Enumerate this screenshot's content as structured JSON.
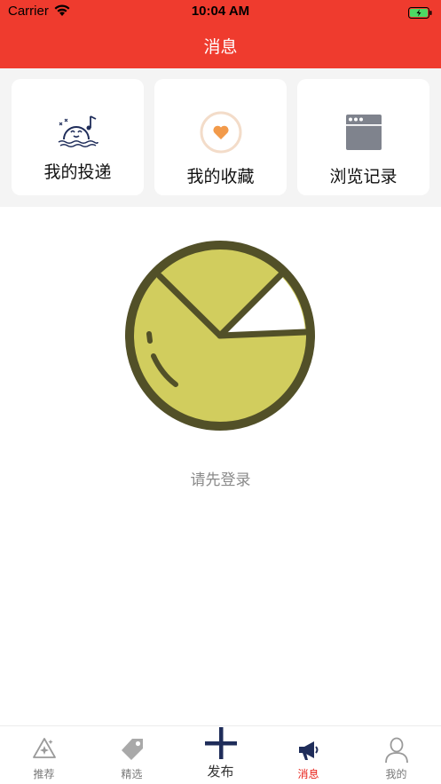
{
  "status_bar": {
    "carrier": "Carrier",
    "time": "10:04 AM"
  },
  "nav": {
    "title": "消息"
  },
  "cards": [
    {
      "label": "我的投递",
      "icon": "delivery-icon"
    },
    {
      "label": "我的收藏",
      "icon": "favorite-heart-icon"
    },
    {
      "label": "浏览记录",
      "icon": "browser-history-icon"
    }
  ],
  "empty_state": {
    "illustration": "pie-chart-icon",
    "message": "请先登录"
  },
  "tab_bar": {
    "items": [
      {
        "label": "推荐",
        "icon": "recommend-icon",
        "active": false
      },
      {
        "label": "精选",
        "icon": "tag-icon",
        "active": false
      },
      {
        "label": "发布",
        "icon": "plus-icon",
        "active": false
      },
      {
        "label": "消息",
        "icon": "megaphone-icon",
        "active": true
      },
      {
        "label": "我的",
        "icon": "user-icon",
        "active": false
      }
    ]
  },
  "colors": {
    "brand": "#ef3b2e",
    "active_tab": "#e8231b",
    "navy": "#1f2d5a"
  }
}
